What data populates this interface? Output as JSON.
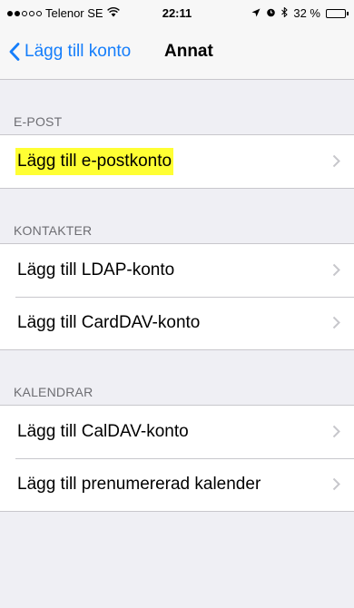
{
  "status_bar": {
    "carrier": "Telenor SE",
    "time": "22:11",
    "battery_text": "32 %",
    "battery_level": 0.32
  },
  "nav": {
    "back_label": "Lägg till konto",
    "title": "Annat"
  },
  "sections": [
    {
      "header": "E-POST",
      "items": [
        {
          "label": "Lägg till e-postkonto",
          "highlighted": true
        }
      ]
    },
    {
      "header": "KONTAKTER",
      "items": [
        {
          "label": "Lägg till LDAP-konto"
        },
        {
          "label": "Lägg till CardDAV-konto"
        }
      ]
    },
    {
      "header": "KALENDRAR",
      "items": [
        {
          "label": "Lägg till CalDAV-konto"
        },
        {
          "label": "Lägg till prenumererad kalender"
        }
      ]
    }
  ],
  "colors": {
    "accent": "#157efb",
    "highlight": "#ffff33",
    "background": "#efeff4"
  }
}
